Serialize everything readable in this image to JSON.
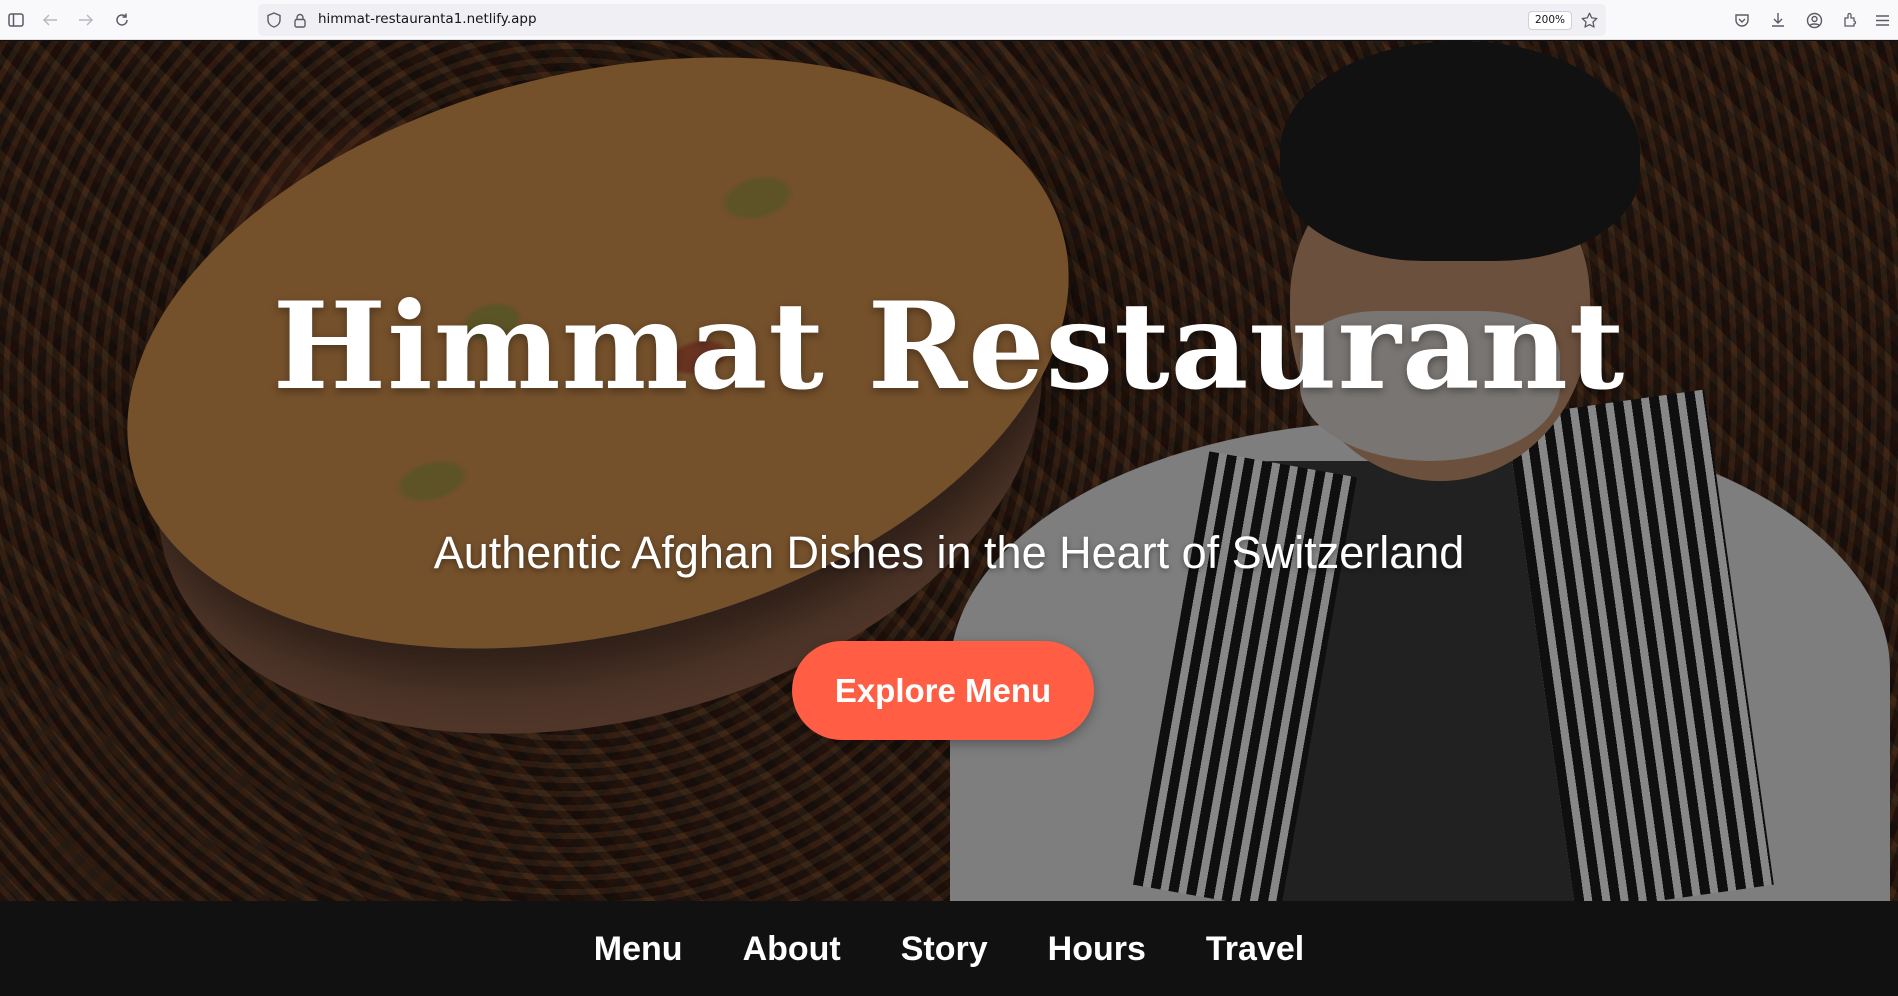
{
  "browser": {
    "url": "himmat-restauranta1.netlify.app",
    "zoom": "200%",
    "icons": {
      "sidebar": "sidebar-icon",
      "back": "back-arrow-icon",
      "forward": "forward-arrow-icon",
      "reload": "reload-icon",
      "shield": "shield-icon",
      "lock": "lock-icon",
      "bookmark": "star-icon",
      "pocket": "pocket-icon",
      "downloads": "download-icon",
      "account": "account-icon",
      "extensions": "extensions-icon",
      "menu": "hamburger-menu-icon"
    }
  },
  "hero": {
    "title": "Himmat Restaurant",
    "subtitle": "Authentic Afghan Dishes in the Heart of Switzerland",
    "cta_label": "Explore Menu",
    "cta_color": "#ff5e45"
  },
  "nav": {
    "items": [
      {
        "label": "Menu"
      },
      {
        "label": "About"
      },
      {
        "label": "Story"
      },
      {
        "label": "Hours"
      },
      {
        "label": "Travel"
      }
    ]
  }
}
